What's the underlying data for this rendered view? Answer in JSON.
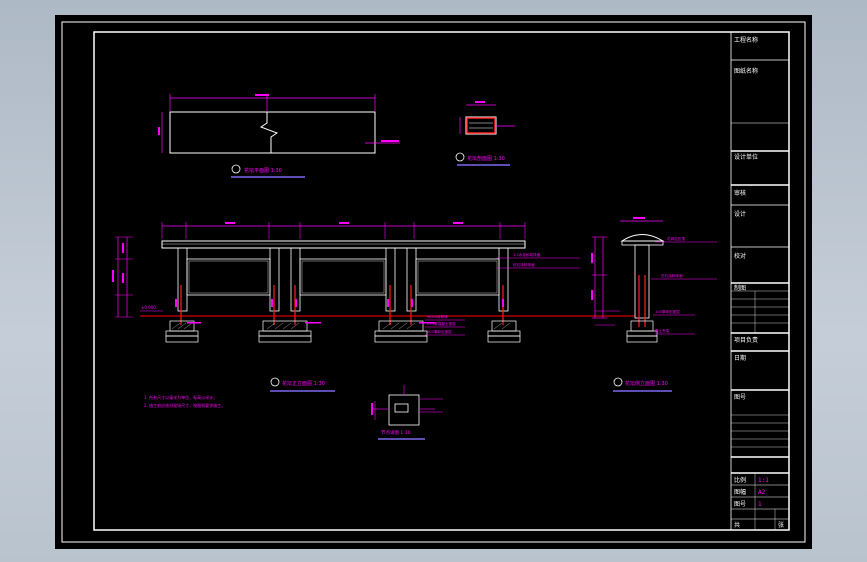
{
  "drawing": {
    "view_labels": {
      "plan": "花坛平面图  1:30",
      "section": "花坛剖面图  1:30",
      "front": "花坛正立面图  1:30",
      "side": "花坛侧立面图  1:30",
      "detail": "节点详图  1:10"
    },
    "notes": [
      "1. 所有尺寸以毫米为单位，标高以米计。",
      "2. 施工前应核对现场尺寸，按图纸要求施工。"
    ],
    "callouts": [
      "1:2水泥砂浆抹面",
      "花岗岩压顶",
      "仿石涂料饰面",
      "MU10砖砌体",
      "C15素混凝土垫层",
      "100厚碎石垫层",
      "素土夯实"
    ],
    "elevation_marker": "±0.000"
  },
  "title_block": {
    "rows": [
      "工程名称",
      "图纸名称",
      "设计单位",
      "审核",
      "设计",
      "校对",
      "制图",
      "项目负责",
      "日期",
      "图号"
    ],
    "scale_label": "比例",
    "scale_value": "1:1",
    "size_label": "图幅",
    "size_value": "A2",
    "sheet_label": "图号",
    "sheet_value": "1",
    "total_label": "共",
    "total_value": "张"
  },
  "colors": {
    "frame": "#ffffff",
    "geometry": "#ffffff",
    "dimension": "#ff00ff",
    "annotation": "#ff00ff",
    "ground_line": "#ff0000",
    "section_fill": "#ff0000",
    "label_underline": "#7b68ee"
  }
}
